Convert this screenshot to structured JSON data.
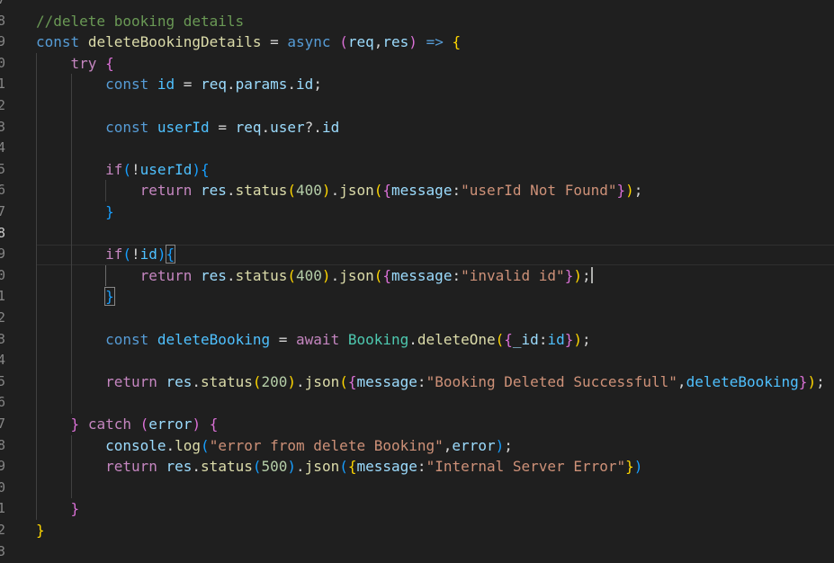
{
  "editor": {
    "language": "javascript",
    "active_line": 10,
    "colors": {
      "background": "#1f1f1f",
      "comment": "#6a9955",
      "keyword": "#569cd6",
      "control": "#c586c0",
      "function": "#dcdcaa",
      "variable": "#9cdcfe",
      "constant": "#4fc1ff",
      "number": "#b5cea8",
      "string": "#ce9178",
      "bracket_1": "#ffd700",
      "bracket_2": "#da70d6",
      "bracket_3": "#179fff"
    }
  },
  "gutter": {
    "line_numbers": [
      "7",
      "8",
      "9",
      "0",
      "1",
      "2",
      "3",
      "4",
      "5",
      "6",
      "7",
      "8",
      "9",
      "0",
      "1",
      "2",
      "3",
      "4",
      "5",
      "6",
      "7",
      "8",
      "9",
      "0",
      "1",
      "2",
      "3"
    ]
  },
  "code": {
    "lines": [
      [
        [
          "com",
          "//delete booking details"
        ]
      ],
      [
        [
          "kw",
          "const"
        ],
        [
          "pl",
          " "
        ],
        [
          "fn",
          "deleteBookingDetails"
        ],
        [
          "pl",
          " "
        ],
        [
          "op",
          "="
        ],
        [
          "pl",
          " "
        ],
        [
          "kw",
          "async"
        ],
        [
          "pl",
          " "
        ],
        [
          "b2",
          "("
        ],
        [
          "var",
          "req"
        ],
        [
          "pl",
          ","
        ],
        [
          "var",
          "res"
        ],
        [
          "b2",
          ")"
        ],
        [
          "pl",
          " "
        ],
        [
          "kw",
          "=>"
        ],
        [
          "pl",
          " "
        ],
        [
          "b1",
          "{"
        ]
      ],
      [
        [
          "pl",
          "    "
        ],
        [
          "ctl",
          "try"
        ],
        [
          "pl",
          " "
        ],
        [
          "b2",
          "{"
        ]
      ],
      [
        [
          "pl",
          "        "
        ],
        [
          "kw",
          "const"
        ],
        [
          "pl",
          " "
        ],
        [
          "cst",
          "id"
        ],
        [
          "pl",
          " "
        ],
        [
          "op",
          "="
        ],
        [
          "pl",
          " "
        ],
        [
          "var",
          "req"
        ],
        [
          "pl",
          "."
        ],
        [
          "var",
          "params"
        ],
        [
          "pl",
          "."
        ],
        [
          "var",
          "id"
        ],
        [
          "pl",
          ";"
        ]
      ],
      [],
      [
        [
          "pl",
          "        "
        ],
        [
          "kw",
          "const"
        ],
        [
          "pl",
          " "
        ],
        [
          "cst",
          "userId"
        ],
        [
          "pl",
          " "
        ],
        [
          "op",
          "="
        ],
        [
          "pl",
          " "
        ],
        [
          "var",
          "req"
        ],
        [
          "pl",
          "."
        ],
        [
          "var",
          "user"
        ],
        [
          "pl",
          "?."
        ],
        [
          "var",
          "id"
        ]
      ],
      [],
      [
        [
          "pl",
          "        "
        ],
        [
          "ctl",
          "if"
        ],
        [
          "b3",
          "("
        ],
        [
          "op",
          "!"
        ],
        [
          "cst",
          "userId"
        ],
        [
          "b3",
          ")"
        ],
        [
          "b3",
          "{"
        ]
      ],
      [
        [
          "pl",
          "            "
        ],
        [
          "ctl",
          "return"
        ],
        [
          "pl",
          " "
        ],
        [
          "var",
          "res"
        ],
        [
          "pl",
          "."
        ],
        [
          "fn",
          "status"
        ],
        [
          "b1",
          "("
        ],
        [
          "num",
          "400"
        ],
        [
          "b1",
          ")"
        ],
        [
          "pl",
          "."
        ],
        [
          "fn",
          "json"
        ],
        [
          "b1",
          "("
        ],
        [
          "b2",
          "{"
        ],
        [
          "var",
          "message"
        ],
        [
          "pl",
          ":"
        ],
        [
          "str",
          "\"userId Not Found\""
        ],
        [
          "b2",
          "}"
        ],
        [
          "b1",
          ")"
        ],
        [
          "pl",
          ";"
        ]
      ],
      [
        [
          "pl",
          "        "
        ],
        [
          "b3",
          "}"
        ]
      ],
      [],
      [
        [
          "pl",
          "        "
        ],
        [
          "ctl",
          "if"
        ],
        [
          "b3",
          "("
        ],
        [
          "op",
          "!"
        ],
        [
          "cst",
          "id"
        ],
        [
          "b3",
          ")"
        ],
        [
          "b3box",
          "{"
        ]
      ],
      [
        [
          "pl",
          "            "
        ],
        [
          "ctl",
          "return"
        ],
        [
          "pl",
          " "
        ],
        [
          "var",
          "res"
        ],
        [
          "pl",
          "."
        ],
        [
          "fn",
          "status"
        ],
        [
          "b1",
          "("
        ],
        [
          "num",
          "400"
        ],
        [
          "b1",
          ")"
        ],
        [
          "pl",
          "."
        ],
        [
          "fn",
          "json"
        ],
        [
          "b1",
          "("
        ],
        [
          "b2",
          "{"
        ],
        [
          "var",
          "message"
        ],
        [
          "pl",
          ":"
        ],
        [
          "str",
          "\"invalid id\""
        ],
        [
          "b2",
          "}"
        ],
        [
          "b1",
          ")"
        ],
        [
          "pl",
          ";"
        ],
        [
          "cursor",
          ""
        ]
      ],
      [
        [
          "pl",
          "        "
        ],
        [
          "b3box",
          "}"
        ]
      ],
      [],
      [
        [
          "pl",
          "        "
        ],
        [
          "kw",
          "const"
        ],
        [
          "pl",
          " "
        ],
        [
          "cst",
          "deleteBooking"
        ],
        [
          "pl",
          " "
        ],
        [
          "op",
          "="
        ],
        [
          "pl",
          " "
        ],
        [
          "ctl",
          "await"
        ],
        [
          "pl",
          " "
        ],
        [
          "cls",
          "Booking"
        ],
        [
          "pl",
          "."
        ],
        [
          "fn",
          "deleteOne"
        ],
        [
          "b1",
          "("
        ],
        [
          "b2",
          "{"
        ],
        [
          "var",
          "_id"
        ],
        [
          "pl",
          ":"
        ],
        [
          "cst",
          "id"
        ],
        [
          "b2",
          "}"
        ],
        [
          "b1",
          ")"
        ],
        [
          "pl",
          ";"
        ]
      ],
      [],
      [
        [
          "pl",
          "        "
        ],
        [
          "ctl",
          "return"
        ],
        [
          "pl",
          " "
        ],
        [
          "var",
          "res"
        ],
        [
          "pl",
          "."
        ],
        [
          "fn",
          "status"
        ],
        [
          "b1",
          "("
        ],
        [
          "num",
          "200"
        ],
        [
          "b1",
          ")"
        ],
        [
          "pl",
          "."
        ],
        [
          "fn",
          "json"
        ],
        [
          "b1",
          "("
        ],
        [
          "b2",
          "{"
        ],
        [
          "var",
          "message"
        ],
        [
          "pl",
          ":"
        ],
        [
          "str",
          "\"Booking Deleted Successfull\""
        ],
        [
          "pl",
          ","
        ],
        [
          "cst",
          "deleteBooking"
        ],
        [
          "b2",
          "}"
        ],
        [
          "b1",
          ")"
        ],
        [
          "pl",
          ";"
        ]
      ],
      [],
      [
        [
          "pl",
          "    "
        ],
        [
          "b2",
          "}"
        ],
        [
          "pl",
          " "
        ],
        [
          "ctl",
          "catch"
        ],
        [
          "pl",
          " "
        ],
        [
          "b2",
          "("
        ],
        [
          "var",
          "error"
        ],
        [
          "b2",
          ")"
        ],
        [
          "pl",
          " "
        ],
        [
          "b2",
          "{"
        ]
      ],
      [
        [
          "pl",
          "        "
        ],
        [
          "var",
          "console"
        ],
        [
          "pl",
          "."
        ],
        [
          "fn",
          "log"
        ],
        [
          "b3",
          "("
        ],
        [
          "str",
          "\"error from delete Booking\""
        ],
        [
          "pl",
          ","
        ],
        [
          "var",
          "error"
        ],
        [
          "b3",
          ")"
        ],
        [
          "pl",
          ";"
        ]
      ],
      [
        [
          "pl",
          "        "
        ],
        [
          "ctl",
          "return"
        ],
        [
          "pl",
          " "
        ],
        [
          "var",
          "res"
        ],
        [
          "pl",
          "."
        ],
        [
          "fn",
          "status"
        ],
        [
          "b3",
          "("
        ],
        [
          "num",
          "500"
        ],
        [
          "b3",
          ")"
        ],
        [
          "pl",
          "."
        ],
        [
          "fn",
          "json"
        ],
        [
          "b3",
          "("
        ],
        [
          "b1",
          "{"
        ],
        [
          "var",
          "message"
        ],
        [
          "pl",
          ":"
        ],
        [
          "str",
          "\"Internal Server Error\""
        ],
        [
          "b1",
          "}"
        ],
        [
          "b3",
          ")"
        ]
      ],
      [],
      [
        [
          "pl",
          "    "
        ],
        [
          "b2",
          "}"
        ]
      ],
      [
        [
          "b1",
          "}"
        ]
      ],
      []
    ]
  }
}
